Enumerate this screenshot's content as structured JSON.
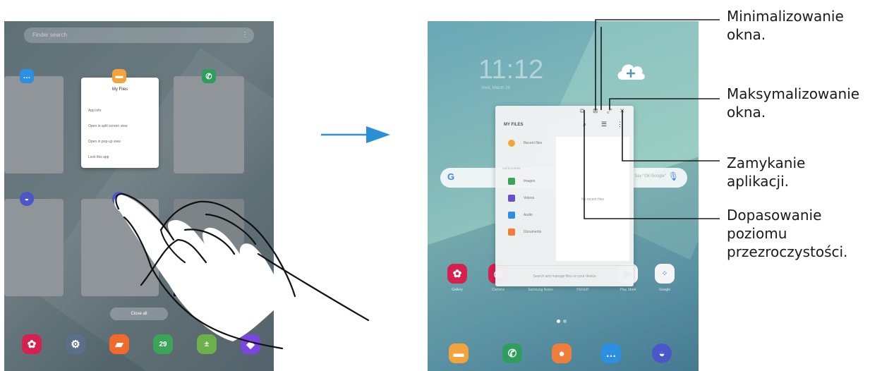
{
  "left_tablet": {
    "finder_placeholder": "Finder search",
    "menu_card": {
      "title": "My Files",
      "items": [
        "App info",
        "Open in split screen view",
        "Open in pop-up view",
        "Lock this app"
      ]
    },
    "close_all_label": "Close all",
    "calendar_day": "29"
  },
  "right_tablet": {
    "clock_time": "11:12",
    "clock_date": "Wed, March 28",
    "google_hint": "Say \"Ok Google\"",
    "popup": {
      "app_title": "MY FILES",
      "recent_label": "Recent files",
      "categories_label": "CATEGORIES",
      "items": [
        "Images",
        "Videos",
        "Audio",
        "Documents"
      ],
      "empty_text": "No recent files",
      "footer_text": "Search and manage files on your device"
    },
    "home_app_labels": [
      "Gallery",
      "Camera",
      "Samsung Notes",
      "PENUP",
      "Play Store",
      "Google"
    ]
  },
  "callouts": {
    "minimize": [
      "Minimalizowanie",
      "okna."
    ],
    "maximize": [
      "Maksymalizowanie",
      "okna."
    ],
    "close": [
      "Zamykanie",
      "aplikacji."
    ],
    "opacity": [
      "Dopasowanie",
      "poziomu",
      "przezroczystości."
    ]
  },
  "colors": {
    "arrow": "#2b8fd6",
    "gallery": "#d6204f",
    "settings": "#5b6f86",
    "notes": "#f06a2c",
    "calendar": "#3aa556",
    "calculator": "#6bb04a",
    "store": "#7b46e0",
    "myfiles": "#f2a33c",
    "phone": "#2f9e5b",
    "contacts": "#f07e3b",
    "messages": "#2c8fe0",
    "internet": "#4b56c9"
  }
}
